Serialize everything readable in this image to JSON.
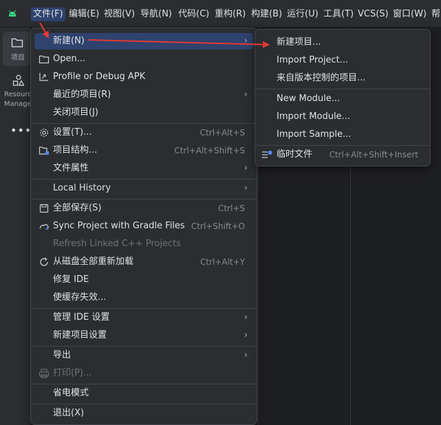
{
  "menubar": {
    "items": [
      {
        "label": "文件(F)",
        "active": true
      },
      {
        "label": "编辑(E)"
      },
      {
        "label": "视图(V)"
      },
      {
        "label": "导航(N)"
      },
      {
        "label": "代码(C)"
      },
      {
        "label": "重构(R)"
      },
      {
        "label": "构建(B)"
      },
      {
        "label": "运行(U)"
      },
      {
        "label": "工具(T)"
      },
      {
        "label": "VCS(S)"
      },
      {
        "label": "窗口(W)"
      },
      {
        "label": "帮"
      }
    ]
  },
  "sidebar": {
    "project_label": "项目",
    "resource_label_1": "Resourc",
    "resource_label_2": "Manage",
    "more": "•••"
  },
  "file_menu": {
    "items": [
      {
        "label": "新建(N)",
        "submenu": true,
        "highlighted": true
      },
      {
        "label": "Open...",
        "icon": "folder-icon"
      },
      {
        "label": "Profile or Debug APK",
        "icon": "profile-icon"
      },
      {
        "label": "最近的项目(R)",
        "submenu": true
      },
      {
        "label": "关闭项目(J)"
      },
      {
        "label": "设置(T)...",
        "icon": "gear-icon",
        "shortcut": "Ctrl+Alt+S"
      },
      {
        "label": "项目结构...",
        "icon": "project-structure-icon",
        "shortcut": "Ctrl+Alt+Shift+S"
      },
      {
        "label": "文件属性",
        "submenu": true
      },
      {
        "label": "Local History",
        "submenu": true
      },
      {
        "label": "全部保存(S)",
        "icon": "save-icon",
        "shortcut": "Ctrl+S"
      },
      {
        "label": "Sync Project with Gradle Files",
        "icon": "gradle-sync-icon",
        "shortcut": "Ctrl+Shift+O"
      },
      {
        "label": "Refresh Linked C++ Projects",
        "disabled": true
      },
      {
        "label": "从磁盘全部重新加载",
        "icon": "reload-icon",
        "shortcut": "Ctrl+Alt+Y"
      },
      {
        "label": "修复 IDE"
      },
      {
        "label": "使缓存失效..."
      },
      {
        "label": "管理 IDE 设置",
        "submenu": true
      },
      {
        "label": "新建项目设置",
        "submenu": true
      },
      {
        "label": "导出",
        "submenu": true
      },
      {
        "label": "打印(P)...",
        "icon": "printer-icon",
        "disabled": true
      },
      {
        "label": "省电模式"
      },
      {
        "label": "退出(X)"
      }
    ]
  },
  "new_submenu": {
    "items": [
      {
        "label": "新建项目..."
      },
      {
        "label": "Import Project..."
      },
      {
        "label": "来自版本控制的项目..."
      },
      {
        "label": "New Module..."
      },
      {
        "label": "Import Module..."
      },
      {
        "label": "Import Sample..."
      },
      {
        "label": "临时文件",
        "icon": "scratch-file-icon",
        "shortcut": "Ctrl+Alt+Shift+Insert"
      }
    ]
  },
  "colors": {
    "highlight": "#2e436e",
    "annotation_arrow": "#e53935",
    "background": "#1e1f22",
    "panel": "#2b2d30"
  }
}
